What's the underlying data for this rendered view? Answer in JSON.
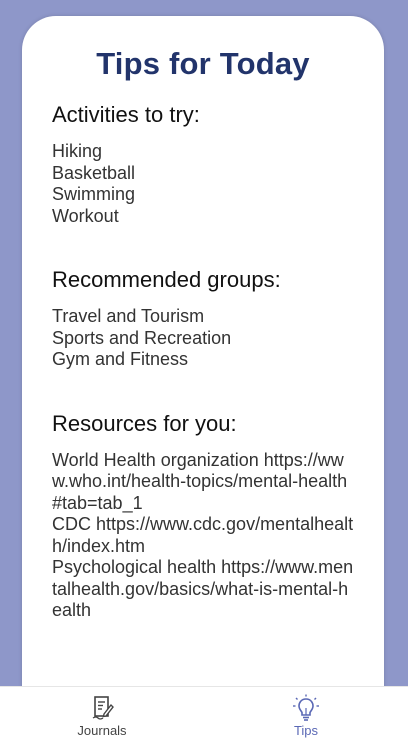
{
  "page": {
    "title": "Tips for Today"
  },
  "activities": {
    "heading": "Activities to try:",
    "items": [
      "Hiking",
      "Basketball",
      "Swimming",
      "Workout"
    ]
  },
  "groups": {
    "heading": "Recommended groups:",
    "items": [
      "Travel and Tourism",
      "Sports and Recreation",
      "Gym and Fitness"
    ]
  },
  "resources": {
    "heading": "Resources for you:",
    "items": [
      "World Health organization https://www.who.int/health-topics/mental-health#tab=tab_1",
      "CDC https://www.cdc.gov/mentalhealth/index.htm",
      "Psychological health https://www.mentalhealth.gov/basics/what-is-mental-health"
    ]
  },
  "tabbar": {
    "journals": {
      "label": "Journals",
      "icon": "journal-edit-icon"
    },
    "tips": {
      "label": "Tips",
      "icon": "lightbulb-icon",
      "active": true
    }
  },
  "colors": {
    "background": "#8e97c9",
    "title": "#22346b",
    "active_tab": "#5a68b5"
  }
}
